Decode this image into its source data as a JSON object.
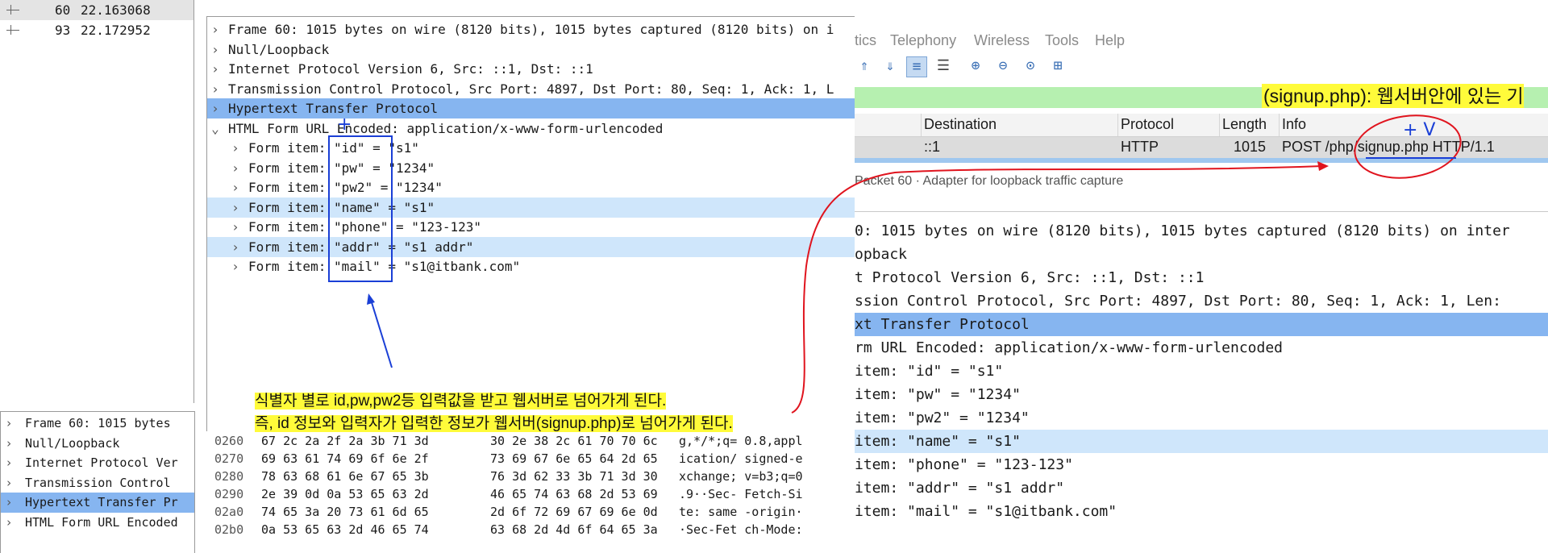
{
  "left": {
    "packet_list": [
      {
        "num": "60",
        "time": "22.163068",
        "selected": true
      },
      {
        "num": "93",
        "time": "22.172952",
        "selected": false
      }
    ],
    "detail_rows": [
      {
        "arrow": ">",
        "indent": 0,
        "text": "Frame 60: 1015 bytes on wire (8120 bits), 1015 bytes captured (8120 bits) on i",
        "style": ""
      },
      {
        "arrow": ">",
        "indent": 0,
        "text": "Null/Loopback",
        "style": ""
      },
      {
        "arrow": ">",
        "indent": 0,
        "text": "Internet Protocol Version 6, Src: ::1, Dst: ::1",
        "style": ""
      },
      {
        "arrow": ">",
        "indent": 0,
        "text": "Transmission Control Protocol, Src Port: 4897, Dst Port: 80, Seq: 1, Ack: 1, L",
        "style": ""
      },
      {
        "arrow": ">",
        "indent": 0,
        "text": "Hypertext Transfer Protocol",
        "style": "blue"
      },
      {
        "arrow": "v",
        "indent": 0,
        "text": "HTML Form URL Encoded: application/x-www-form-urlencoded",
        "style": ""
      },
      {
        "arrow": ">",
        "indent": 1,
        "text": "Form item: \"id\" = \"s1\"",
        "style": ""
      },
      {
        "arrow": ">",
        "indent": 1,
        "text": "Form item: \"pw\" = \"1234\"",
        "style": ""
      },
      {
        "arrow": ">",
        "indent": 1,
        "text": "Form item: \"pw2\" = \"1234\"",
        "style": ""
      },
      {
        "arrow": ">",
        "indent": 1,
        "text": "Form item: \"name\" = \"s1\"",
        "style": "lblue"
      },
      {
        "arrow": ">",
        "indent": 1,
        "text": "Form item: \"phone\" = \"123-123\"",
        "style": ""
      },
      {
        "arrow": ">",
        "indent": 1,
        "text": "Form item: \"addr\" = \"s1 addr\"",
        "style": "lblue"
      },
      {
        "arrow": ">",
        "indent": 1,
        "text": "Form item: \"mail\" = \"s1@itbank.com\"",
        "style": ""
      }
    ],
    "bottom_tree": [
      {
        "arrow": ">",
        "text": "Frame 60: 1015 bytes",
        "style": ""
      },
      {
        "arrow": ">",
        "text": "Null/Loopback",
        "style": ""
      },
      {
        "arrow": ">",
        "text": "Internet Protocol Ver",
        "style": ""
      },
      {
        "arrow": ">",
        "text": "Transmission Control",
        "style": ""
      },
      {
        "arrow": ">",
        "text": "Hypertext Transfer Pr",
        "style": "blue"
      },
      {
        "arrow": ">",
        "text": "HTML Form URL Encoded",
        "style": ""
      }
    ],
    "hex_rows": [
      {
        "off": "0260",
        "b1": "67 2c 2a 2f 2a 3b 71 3d",
        "b2": "30 2e 38 2c 61 70 70 6c",
        "ascii": "g,*/*;q= 0.8,appl"
      },
      {
        "off": "0270",
        "b1": "69 63 61 74 69 6f 6e 2f",
        "b2": "73 69 67 6e 65 64 2d 65",
        "ascii": "ication/ signed-e"
      },
      {
        "off": "0280",
        "b1": "78 63 68 61 6e 67 65 3b",
        "b2": "76 3d 62 33 3b 71 3d 30",
        "ascii": "xchange; v=b3;q=0"
      },
      {
        "off": "0290",
        "b1": "2e 39 0d 0a 53 65 63 2d",
        "b2": "46 65 74 63 68 2d 53 69",
        "ascii": ".9··Sec- Fetch-Si"
      },
      {
        "off": "02a0",
        "b1": "74 65 3a 20 73 61 6d 65",
        "b2": "2d 6f 72 69 67 69 6e 0d",
        "ascii": "te: same -origin·"
      },
      {
        "off": "02b0",
        "b1": "0a 53 65 63 2d 46 65 74",
        "b2": "63 68 2d 4d 6f 64 65 3a",
        "ascii": "·Sec-Fet ch-Mode:"
      }
    ],
    "note_lines": [
      "식별자 별로 id,pw,pw2등 입력값을 받고 웹서버로 넘어가게 된다.",
      "즉, id 정보와 입력자가 입력한 정보가 웹서버(signup.php)로 넘어가게 된다."
    ]
  },
  "right": {
    "menu": [
      "tics",
      "Telephony",
      "Wireless",
      "Tools",
      "Help"
    ],
    "toolbar_icons": [
      "go-up-icon",
      "go-down-icon",
      "autoscroll-icon",
      "colorize-icon",
      "zoom-in-icon",
      "zoom-out-icon",
      "zoom-normal-icon",
      "resize-columns-icon"
    ],
    "highlight_note": "(signup.php): 웹서버안에 있는 기",
    "columns": [
      "Destination",
      "Protocol",
      "Length",
      "Info"
    ],
    "packet": {
      "destination": "::1",
      "protocol": "HTTP",
      "length": "1015",
      "info": "POST /php/signup.php HTTP/1.1"
    },
    "status_text": "Packet 60 · Adapter for loopback traffic capture",
    "detail_rows": [
      {
        "text": "0: 1015 bytes on wire (8120 bits), 1015 bytes captured (8120 bits) on inter",
        "style": ""
      },
      {
        "text": "opback",
        "style": ""
      },
      {
        "text": "t Protocol Version 6, Src: ::1, Dst: ::1",
        "style": ""
      },
      {
        "text": "ssion Control Protocol, Src Port: 4897, Dst Port: 80, Seq: 1, Ack: 1, Len:",
        "style": ""
      },
      {
        "text": "xt Transfer Protocol",
        "style": "blue"
      },
      {
        "text": "rm URL Encoded: application/x-www-form-urlencoded",
        "style": ""
      },
      {
        "text": " item: \"id\" = \"s1\"",
        "style": ""
      },
      {
        "text": " item: \"pw\" = \"1234\"",
        "style": ""
      },
      {
        "text": " item: \"pw2\" = \"1234\"",
        "style": ""
      },
      {
        "text": " item: \"name\" = \"s1\"",
        "style": "lblue"
      },
      {
        "text": " item: \"phone\" = \"123-123\"",
        "style": ""
      },
      {
        "text": " item: \"addr\" = \"s1 addr\"",
        "style": ""
      },
      {
        "text": " item: \"mail\" = \"s1@itbank.com\"",
        "style": ""
      }
    ]
  },
  "annotations": {
    "plus_mark": "+",
    "check_mark": "+ V"
  }
}
